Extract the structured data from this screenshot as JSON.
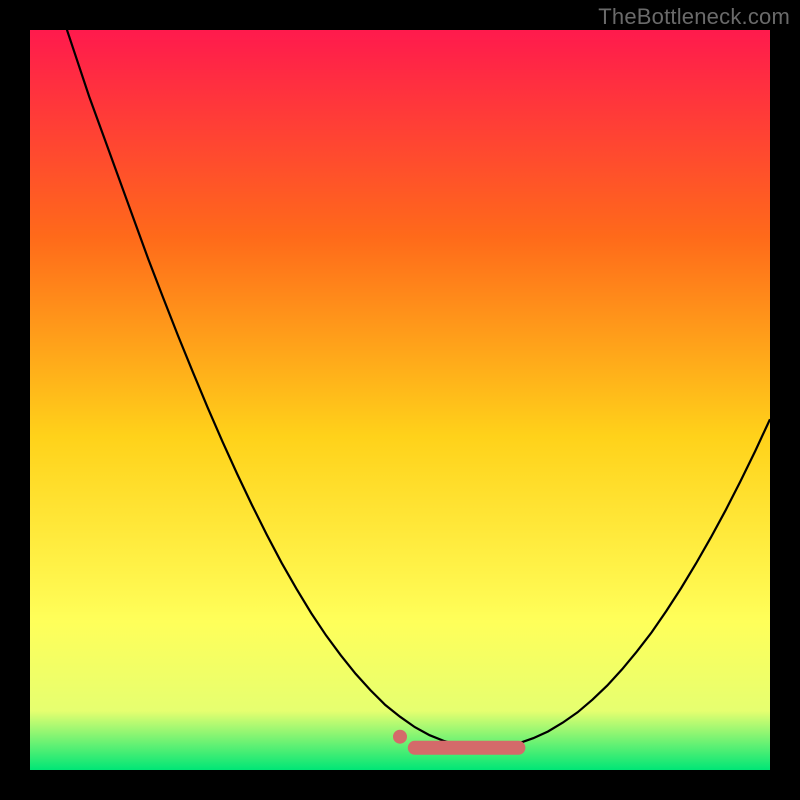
{
  "watermark": "TheBottleneck.com",
  "colors": {
    "frame_bg": "#000000",
    "gradient_top": "#ff1a4d",
    "gradient_mid1": "#ff7a1a",
    "gradient_mid2": "#ffd21a",
    "gradient_mid3": "#ffff5a",
    "gradient_bottom": "#00e676",
    "curve": "#000000",
    "marker_fill": "#d46a6a",
    "marker_stroke": "#d46a6a"
  },
  "chart_data": {
    "type": "line",
    "title": "",
    "xlabel": "",
    "ylabel": "",
    "xlim": [
      0,
      100
    ],
    "ylim": [
      0,
      100
    ],
    "x": [
      0,
      2,
      4,
      6,
      8,
      10,
      12,
      14,
      16,
      18,
      20,
      22,
      24,
      26,
      28,
      30,
      32,
      34,
      36,
      38,
      40,
      42,
      44,
      46,
      48,
      50,
      52,
      54,
      56,
      58,
      60,
      62,
      64,
      66,
      68,
      70,
      72,
      74,
      76,
      78,
      80,
      82,
      84,
      86,
      88,
      90,
      92,
      94,
      96,
      98,
      100
    ],
    "series": [
      {
        "name": "bottleneck_curve",
        "y": [
          115,
          109,
          103,
          97,
          91,
          85.5,
          80,
          74.5,
          69,
          63.8,
          58.7,
          53.8,
          49,
          44.4,
          40,
          35.8,
          31.8,
          28,
          24.5,
          21.2,
          18.2,
          15.5,
          13,
          10.8,
          8.8,
          7.2,
          5.8,
          4.7,
          3.9,
          3.3,
          3,
          3,
          3.2,
          3.6,
          4.3,
          5.2,
          6.4,
          7.8,
          9.5,
          11.4,
          13.6,
          16,
          18.6,
          21.5,
          24.6,
          27.9,
          31.4,
          35.1,
          39,
          43.1,
          47.4
        ]
      }
    ],
    "floor_segment": {
      "x_start": 52,
      "x_end": 66,
      "y": 3
    },
    "marker_dot": {
      "x": 50,
      "y": 4.5
    }
  }
}
